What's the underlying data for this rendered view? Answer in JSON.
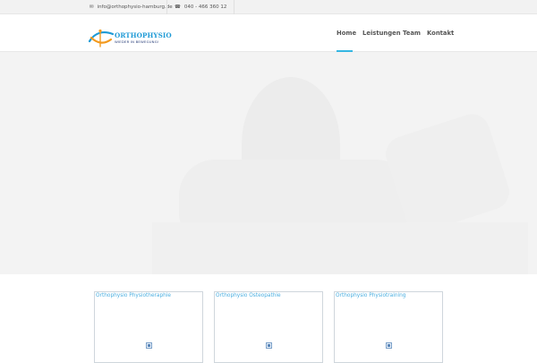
{
  "topbar": {
    "email": "info@orthophysio-hamburg.de",
    "phone": "040 - 466 360 12",
    "email_icon": "envelope-icon",
    "phone_icon": "phone-icon"
  },
  "logo": {
    "title": "ORTHOPHYSIO",
    "subtitle": "WIEDER IN BEWEGUNG!"
  },
  "nav": {
    "items": [
      {
        "label": "Home",
        "active": true
      },
      {
        "label": "Leistungen",
        "active": false
      },
      {
        "label": "Team",
        "active": false
      },
      {
        "label": "Kontakt",
        "active": false
      }
    ]
  },
  "cards": [
    {
      "title": "Orthophysio Physiotheraphie"
    },
    {
      "title": "Orthophysio Osteopathie"
    },
    {
      "title": "Orthophysio Physiotraining"
    }
  ],
  "colors": {
    "accent": "#35b6e2",
    "logo_blue": "#1e9ad6",
    "logo_orange": "#f39a1e",
    "link": "#4aaee0"
  }
}
